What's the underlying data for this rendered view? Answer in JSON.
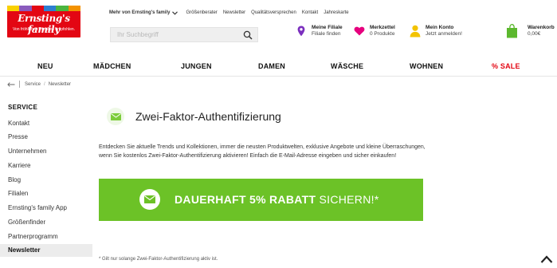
{
  "logo": {
    "name": "Ernsting's family",
    "claim": "Von fröhlichen Familien empfohlen.",
    "stripe_colors": [
      "#f9d100",
      "#8a5bbd",
      "#e30613",
      "#2d7fd1",
      "#4bb53f",
      "#f39200"
    ],
    "bg": "#e30613"
  },
  "topnav": {
    "more": "Mehr von Ernsting's family",
    "links": [
      "Größenberater",
      "Newsletter",
      "Qualitätsversprechen",
      "Kontakt",
      "Jahreskarte"
    ]
  },
  "search": {
    "placeholder": "Ihr Suchbegriff",
    "icon": "search-icon"
  },
  "util": {
    "filiale": {
      "title": "Meine Filiale",
      "sub": "Filiale finden",
      "icon": "location-pin-icon",
      "color": "#7b2fbe"
    },
    "merkzettel": {
      "title": "Merkzettel",
      "sub": "0 Produkte",
      "icon": "heart-icon",
      "color": "#e6007e"
    },
    "konto": {
      "title": "Mein Konto",
      "sub": "Jetzt anmelden!",
      "icon": "user-icon",
      "color": "#f3c300"
    },
    "warenkorb": {
      "title": "Warenkorb",
      "sub": "0,00€",
      "icon": "shopping-bag-icon",
      "color": "#5cb82e"
    }
  },
  "mainnav": [
    "NEU",
    "MÄDCHEN",
    "JUNGEN",
    "DAMEN",
    "WÄSCHE",
    "WOHNEN",
    "% SALE"
  ],
  "breadcrumb": {
    "back_icon": "back-arrow-icon",
    "items": [
      "Service",
      "Newsletter"
    ]
  },
  "sidebar": {
    "title": "SERVICE",
    "items": [
      "Kontakt",
      "Presse",
      "Unternehmen",
      "Karriere",
      "Blog",
      "Filialen",
      "Ernsting's family App",
      "Größenfinder",
      "Partnerprogramm",
      "Newsletter"
    ],
    "active": "Newsletter"
  },
  "content": {
    "icon": "envelope-icon",
    "title": "Zwei-Faktor-Authentifizierung",
    "intro": "Entdecken Sie aktuelle Trends und Kollektionen, immer die neusten Produktwelten, exklusive Angebote und kleine Überraschungen, wenn Sie kostenlos Zwei-Faktor-Authentifizierung aktivieren! Einfach die E-Mail-Adresse eingeben und sicher einkaufen!",
    "banner": {
      "bold": "DAUERHAFT 5% RABATT",
      "rest": " SICHERN!*",
      "bg": "#6cc227",
      "icon": "envelope-icon"
    },
    "footnote": "* Gilt nur solange Zwei-Faktor-Authentifizierung aktiv ist."
  },
  "scroll_top_icon": "chevron-up-icon"
}
